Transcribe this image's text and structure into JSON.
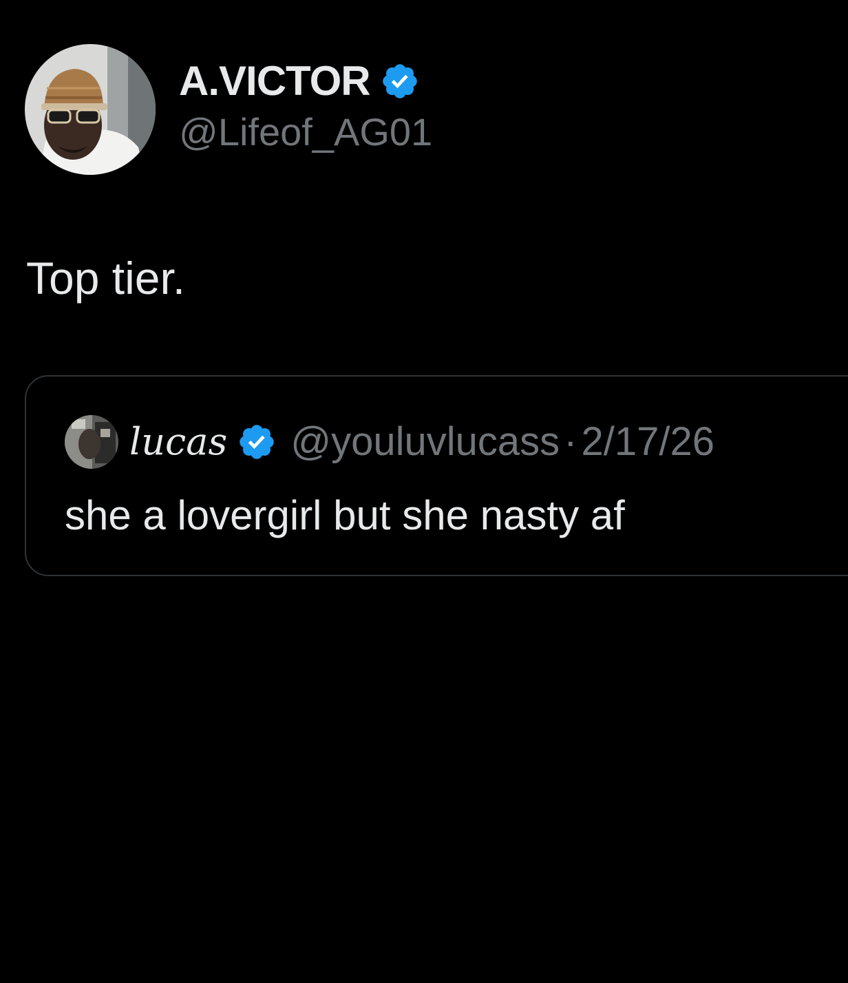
{
  "theme": {
    "background": "#000000",
    "text_primary": "#e7e9ea",
    "text_secondary": "#71767b",
    "verified_badge": "#1d9bf0",
    "border": "#2f3336"
  },
  "author": {
    "display_name": "A.VICTOR",
    "handle": "@Lifeof_AG01",
    "verified": true,
    "verified_icon": "verified-badge-icon",
    "avatar": "profile-photo"
  },
  "tweet": {
    "text": "Top tier."
  },
  "quoted_tweet": {
    "display_name": "lucas",
    "verified": true,
    "handle": "@youluvlucass",
    "separator": "·",
    "date": "2/17/26",
    "text": "she a lovergirl but she nasty af",
    "avatar": "profile-photo"
  }
}
